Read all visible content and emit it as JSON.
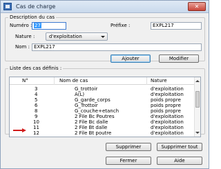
{
  "window": {
    "title": "Cas de charge",
    "close_glyph": "✕"
  },
  "description": {
    "legend": "Description du cas",
    "numero_label": "Numéro :",
    "numero_value": "27",
    "prefixe_label": "Préfixe :",
    "prefixe_value": "EXPL217",
    "nature_label": "Nature :",
    "nature_value": "d'exploitation",
    "nom_label": "Nom :",
    "nom_value": "EXPL217",
    "add_label": "Ajouter",
    "modify_label": "Modifier"
  },
  "list": {
    "legend": "Liste des cas définis :",
    "columns": [
      "N°",
      "Nom de cas",
      "Nature"
    ],
    "rows": [
      [
        "3",
        "G_trottoir",
        "d'exploitation"
      ],
      [
        "4",
        "A(L)",
        "d'exploitation"
      ],
      [
        "5",
        "G_garde_corps",
        "poids propre"
      ],
      [
        "6",
        "G_Trottoir",
        "poids propre"
      ],
      [
        "8",
        "G_couche+etanch",
        "poids propre"
      ],
      [
        "9",
        "2 File Bc Poutres",
        "d'exploitation"
      ],
      [
        "10",
        "2 File Bc dalle",
        "d'exploitation"
      ],
      [
        "11",
        "2 File Bt dalle",
        "d'exploitation"
      ],
      [
        "12",
        "2 File Bt poutre",
        "d'exploitation"
      ]
    ]
  },
  "actions": {
    "delete_label": "Supprimer",
    "delete_all_label": "Supprimer tout",
    "close_label": "Fermer",
    "help_label": "Aide"
  },
  "colors": {
    "pointer_arrow": "#d11b1b",
    "selection": "#3399ff"
  }
}
